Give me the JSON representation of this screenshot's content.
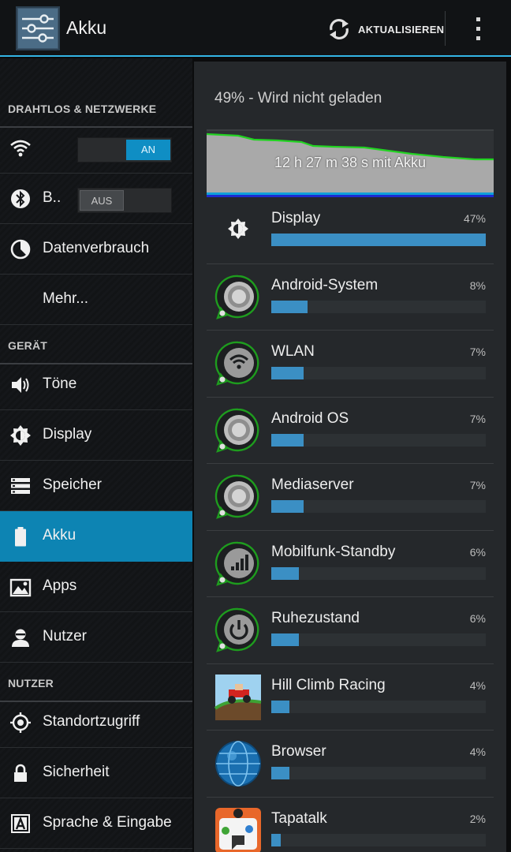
{
  "action_bar": {
    "title": "Akku",
    "refresh_label": "AKTUALISIEREN",
    "accent_color": "#33b5e5"
  },
  "sidebar": {
    "sections": [
      {
        "header": "DRAHTLOS & NETZWERKE"
      },
      {
        "header": "GERÄT"
      },
      {
        "header": "NUTZER"
      }
    ],
    "items": [
      {
        "label": "",
        "icon": "wifi-icon",
        "toggle": "AN",
        "toggle_state": "on"
      },
      {
        "label": "B..",
        "icon": "bluetooth-icon",
        "toggle": "AUS",
        "toggle_state": "off"
      },
      {
        "label": "Datenverbrauch",
        "icon": "data-usage-icon"
      },
      {
        "label": "Mehr...",
        "icon": ""
      },
      {
        "label": "Töne",
        "icon": "speaker-icon"
      },
      {
        "label": "Display",
        "icon": "brightness-icon"
      },
      {
        "label": "Speicher",
        "icon": "storage-icon"
      },
      {
        "label": "Akku",
        "icon": "battery-icon",
        "active": true
      },
      {
        "label": "Apps",
        "icon": "apps-icon"
      },
      {
        "label": "Nutzer",
        "icon": "user-icon"
      },
      {
        "label": "Standortzugriff",
        "icon": "location-icon"
      },
      {
        "label": "Sicherheit",
        "icon": "lock-icon"
      },
      {
        "label": "Sprache & Eingabe",
        "icon": "language-icon"
      }
    ],
    "active_color": "#0d84b3"
  },
  "battery": {
    "status": "49% - Wird nicht geladen",
    "graph_label": "12 h 27 m 38 s mit Akku",
    "usage": [
      {
        "name": "Display",
        "percent": "47%",
        "value": 47,
        "icon": "brightness-icon"
      },
      {
        "name": "Android-System",
        "percent": "8%",
        "value": 8,
        "icon": "android-system-icon"
      },
      {
        "name": "WLAN",
        "percent": "7%",
        "value": 7,
        "icon": "wifi-icon"
      },
      {
        "name": "Android OS",
        "percent": "7%",
        "value": 7,
        "icon": "android-os-icon"
      },
      {
        "name": "Mediaserver",
        "percent": "7%",
        "value": 7,
        "icon": "mediaserver-icon"
      },
      {
        "name": "Mobilfunk-Standby",
        "percent": "6%",
        "value": 6,
        "icon": "cell-signal-icon"
      },
      {
        "name": "Ruhezustand",
        "percent": "6%",
        "value": 6,
        "icon": "power-icon"
      },
      {
        "name": "Hill Climb Racing",
        "percent": "4%",
        "value": 4,
        "icon": "hill-climb-racing-icon"
      },
      {
        "name": "Browser",
        "percent": "4%",
        "value": 4,
        "icon": "browser-icon"
      },
      {
        "name": "Tapatalk",
        "percent": "2%",
        "value": 2,
        "icon": "tapatalk-icon"
      }
    ],
    "bar_color": "#3b8fc4"
  }
}
